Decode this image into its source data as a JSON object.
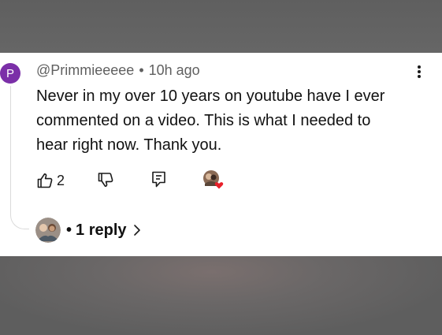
{
  "comment": {
    "avatar_letter": "P",
    "avatar_color": "#7b2fa8",
    "username": "@Primmieeeee",
    "separator": "•",
    "timestamp": "10h ago",
    "text_lines": [
      "Never in my over 10 years on youtube have I ever",
      "commented on a video. This is what I needed to",
      "hear right now. Thank you."
    ]
  },
  "actions": {
    "like_count": "2",
    "like_icon": "thumbs-up-icon",
    "dislike_icon": "thumbs-down-icon",
    "reply_icon": "reply-comment-icon",
    "more_icon": "more-vertical-icon",
    "creator_heart_icon": "creator-heart-icon"
  },
  "replies": {
    "separator": "•",
    "label": "1 reply",
    "chevron_icon": "chevron-right-icon"
  }
}
